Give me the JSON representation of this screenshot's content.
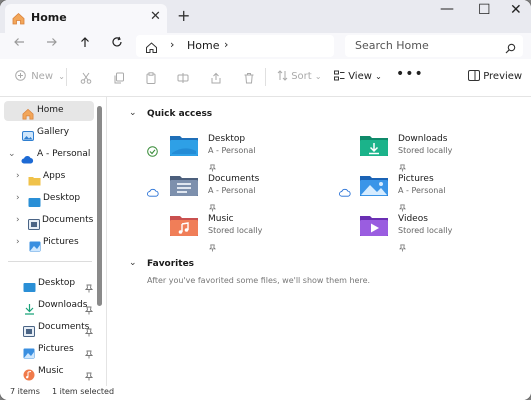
{
  "tab": {
    "title": "Home",
    "close_glyph": "✕",
    "new_tab_glyph": "+"
  },
  "window_controls": {
    "minimize": "—",
    "maximize": "☐",
    "close": "✕"
  },
  "address": {
    "breadcrumb": "Home",
    "separator": "›",
    "search_placeholder": "Search Home"
  },
  "command_bar": {
    "new_label": "New",
    "sort_label": "Sort",
    "view_label": "View",
    "more_glyph": "•••",
    "preview_label": "Preview"
  },
  "sidebar": {
    "home": "Home",
    "gallery": "Gallery",
    "onedrive": "A - Personal",
    "tree": [
      "Apps",
      "Desktop",
      "Documents",
      "Pictures"
    ],
    "pinned": [
      "Desktop",
      "Downloads",
      "Documents",
      "Pictures",
      "Music"
    ]
  },
  "main": {
    "quick_access_title": "Quick access",
    "favorites_title": "Favorites",
    "favorites_empty": "After you've favorited some files, we'll show them here.",
    "items": [
      {
        "name": "Desktop",
        "sub": "A - Personal"
      },
      {
        "name": "Downloads",
        "sub": "Stored locally"
      },
      {
        "name": "Documents",
        "sub": "A - Personal"
      },
      {
        "name": "Pictures",
        "sub": "A - Personal"
      },
      {
        "name": "Music",
        "sub": "Stored locally"
      },
      {
        "name": "Videos",
        "sub": "Stored locally"
      }
    ]
  },
  "status": {
    "count": "7 items",
    "selected": "1 item selected"
  },
  "colors": {
    "accent": "#1a73d9",
    "synced_green": "#3a8d3a",
    "folder_yellow": "#f0c24a"
  }
}
